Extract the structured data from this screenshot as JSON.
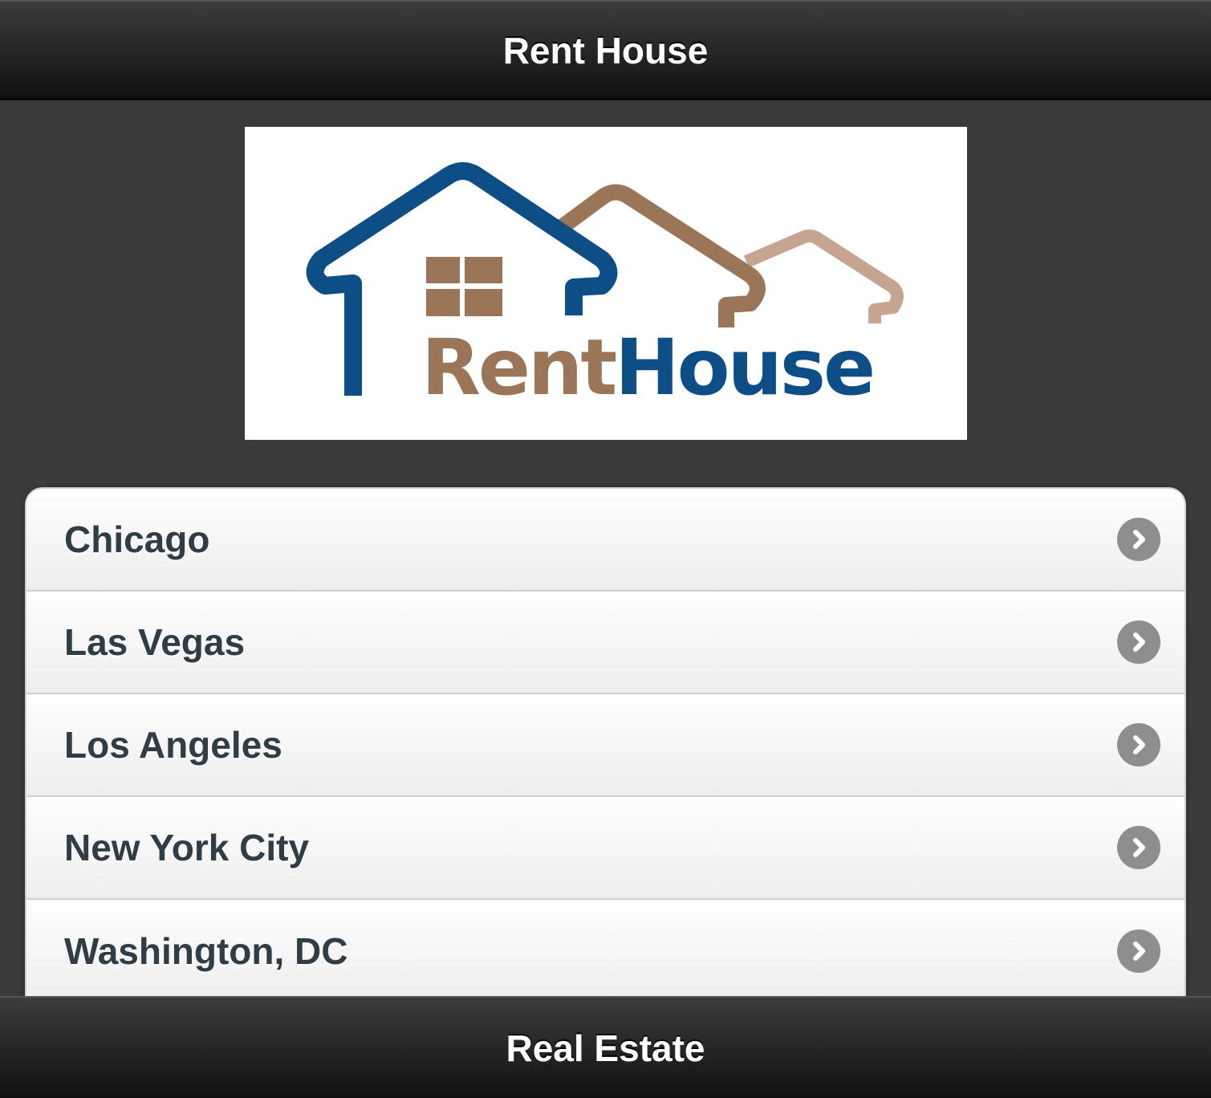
{
  "header": {
    "title": "Rent House"
  },
  "logo": {
    "text_rent": "Rent",
    "text_house": "House",
    "colors": {
      "blue": "#0d4e86",
      "brown": "#9a7558",
      "tan": "#c5a590"
    }
  },
  "list": {
    "items": [
      {
        "label": "Chicago",
        "icon": "chevron-right-icon"
      },
      {
        "label": "Las Vegas",
        "icon": "chevron-right-icon"
      },
      {
        "label": "Los Angeles",
        "icon": "chevron-right-icon"
      },
      {
        "label": "New York City",
        "icon": "chevron-right-icon"
      },
      {
        "label": "Washington, DC",
        "icon": "chevron-right-icon"
      }
    ]
  },
  "footer": {
    "title": "Real Estate"
  }
}
